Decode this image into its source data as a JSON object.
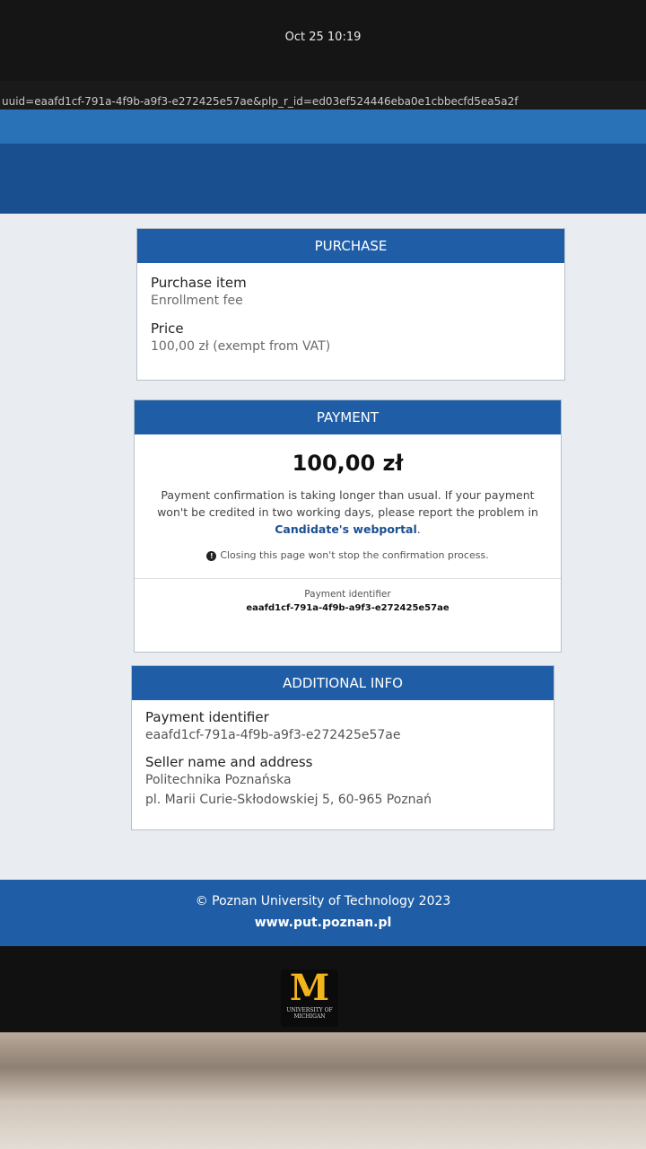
{
  "os": {
    "clock": "Oct 25  10:19"
  },
  "browser": {
    "url_fragment": "uuid=eaafd1cf-791a-4f9b-a9f3-e272425e57ae&plp_r_id=ed03ef524446eba0e1cbbecfd5ea5a2f"
  },
  "purchase": {
    "title": "PURCHASE",
    "item_label": "Purchase item",
    "item_value": "Enrollment fee",
    "price_label": "Price",
    "price_value": "100,00 zł (exempt from VAT)"
  },
  "payment": {
    "title": "PAYMENT",
    "amount": "100,00 zł",
    "notice_text": "Payment confirmation is taking longer than usual. If your payment won't be credited in two working days, please report the problem in",
    "notice_link": "Candidate's webportal",
    "notice_end": ".",
    "closing_note": "Closing this page won't stop the confirmation process.",
    "id_label": "Payment identifier",
    "id_value": "eaafd1cf-791a-4f9b-a9f3-e272425e57ae"
  },
  "additional": {
    "title": "ADDITIONAL INFO",
    "id_label": "Payment identifier",
    "id_value": "eaafd1cf-791a-4f9b-a9f3-e272425e57ae",
    "seller_label": "Seller name and address",
    "seller_name": "Politechnika Poznańska",
    "seller_address": "pl. Marii Curie-Skłodowskiej 5, 60-965 Poznań"
  },
  "footer": {
    "copyright": "© Poznan University of Technology 2023",
    "url": "www.put.poznan.pl"
  },
  "bezel_logo": {
    "letter": "M",
    "line1": "UNIVERSITY OF",
    "line2": "MICHIGAN"
  },
  "colors": {
    "header_dark": "#1a4f8f",
    "header_light": "#2a72b8",
    "accent": "#1f5ea6",
    "logo": "#f2b51c"
  }
}
